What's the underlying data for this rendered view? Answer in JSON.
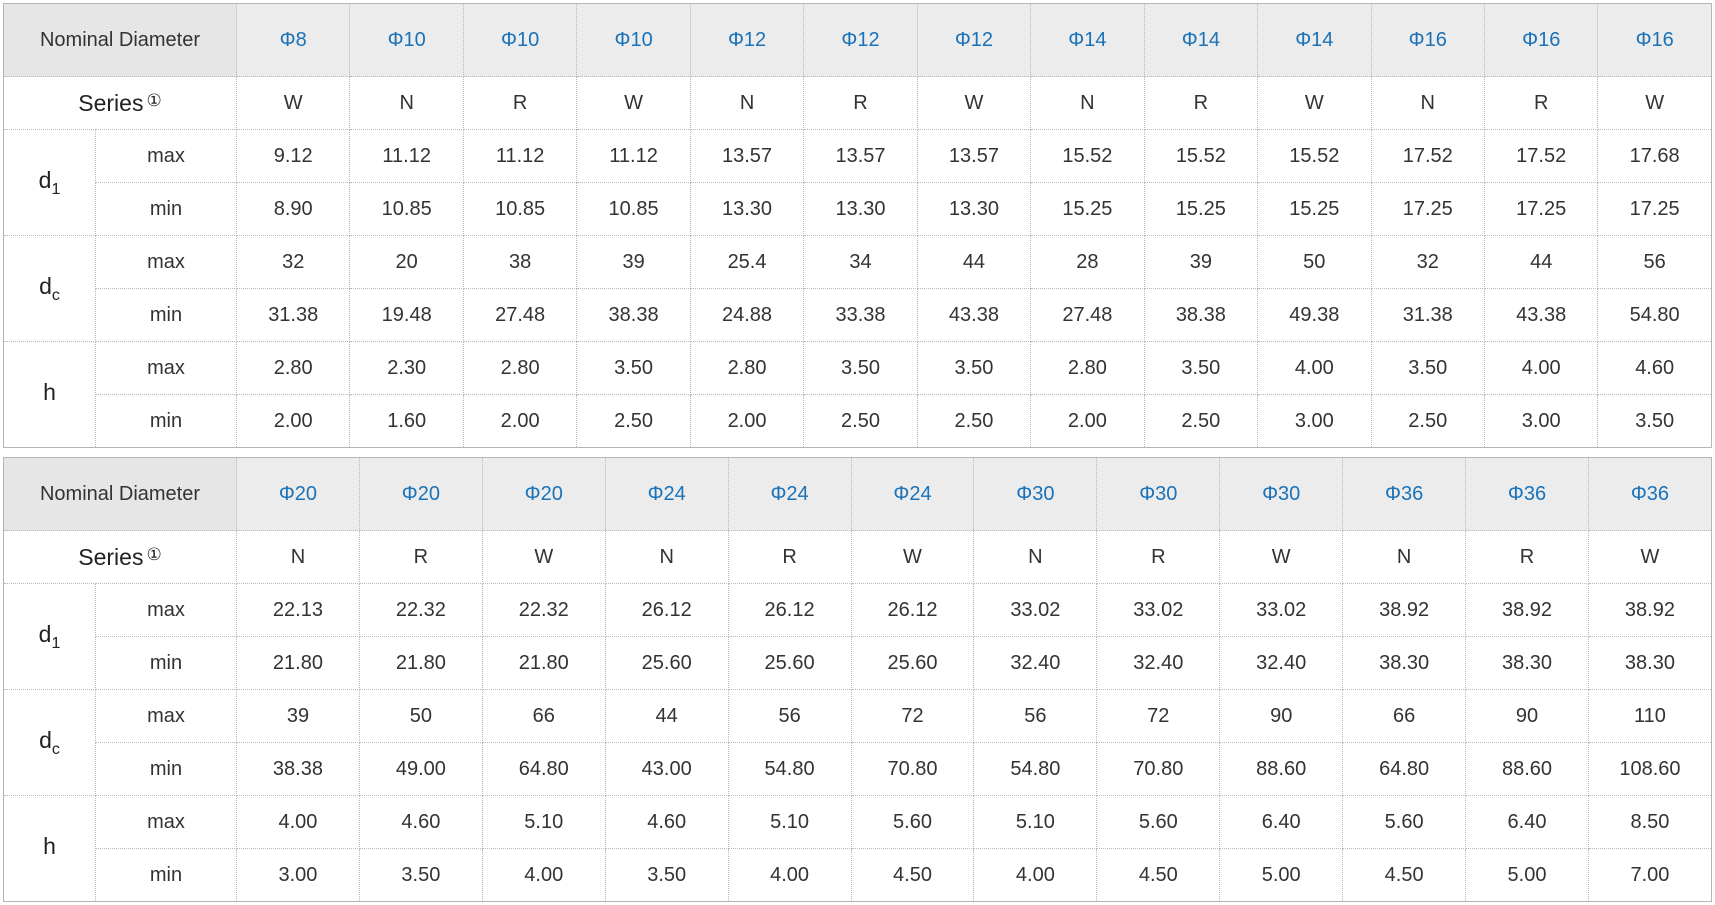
{
  "header_label": "Nominal Diameter",
  "series_label": "Series",
  "series_note": "①",
  "params": [
    {
      "symbol": "d",
      "sub": "1"
    },
    {
      "symbol": "d",
      "sub": "c"
    },
    {
      "symbol": "h",
      "sub": ""
    }
  ],
  "limit_labels": [
    "max",
    "min"
  ],
  "tables": [
    {
      "diameters": [
        "Φ8",
        "Φ10",
        "Φ10",
        "Φ10",
        "Φ12",
        "Φ12",
        "Φ12",
        "Φ14",
        "Φ14",
        "Φ14",
        "Φ16",
        "Φ16",
        "Φ16"
      ],
      "series": [
        "W",
        "N",
        "R",
        "W",
        "N",
        "R",
        "W",
        "N",
        "R",
        "W",
        "N",
        "R",
        "W"
      ],
      "rows": [
        [
          "9.12",
          "11.12",
          "11.12",
          "11.12",
          "13.57",
          "13.57",
          "13.57",
          "15.52",
          "15.52",
          "15.52",
          "17.52",
          "17.52",
          "17.68"
        ],
        [
          "8.90",
          "10.85",
          "10.85",
          "10.85",
          "13.30",
          "13.30",
          "13.30",
          "15.25",
          "15.25",
          "15.25",
          "17.25",
          "17.25",
          "17.25"
        ],
        [
          "32",
          "20",
          "38",
          "39",
          "25.4",
          "34",
          "44",
          "28",
          "39",
          "50",
          "32",
          "44",
          "56"
        ],
        [
          "31.38",
          "19.48",
          "27.48",
          "38.38",
          "24.88",
          "33.38",
          "43.38",
          "27.48",
          "38.38",
          "49.38",
          "31.38",
          "43.38",
          "54.80"
        ],
        [
          "2.80",
          "2.30",
          "2.80",
          "3.50",
          "2.80",
          "3.50",
          "3.50",
          "2.80",
          "3.50",
          "4.00",
          "3.50",
          "4.00",
          "4.60"
        ],
        [
          "2.00",
          "1.60",
          "2.00",
          "2.50",
          "2.00",
          "2.50",
          "2.50",
          "2.00",
          "2.50",
          "3.00",
          "2.50",
          "3.00",
          "3.50"
        ]
      ]
    },
    {
      "diameters": [
        "Φ20",
        "Φ20",
        "Φ20",
        "Φ24",
        "Φ24",
        "Φ24",
        "Φ30",
        "Φ30",
        "Φ30",
        "Φ36",
        "Φ36",
        "Φ36"
      ],
      "series": [
        "N",
        "R",
        "W",
        "N",
        "R",
        "W",
        "N",
        "R",
        "W",
        "N",
        "R",
        "W"
      ],
      "rows": [
        [
          "22.13",
          "22.32",
          "22.32",
          "26.12",
          "26.12",
          "26.12",
          "33.02",
          "33.02",
          "33.02",
          "38.92",
          "38.92",
          "38.92"
        ],
        [
          "21.80",
          "21.80",
          "21.80",
          "25.60",
          "25.60",
          "25.60",
          "32.40",
          "32.40",
          "32.40",
          "38.30",
          "38.30",
          "38.30"
        ],
        [
          "39",
          "50",
          "66",
          "44",
          "56",
          "72",
          "56",
          "72",
          "90",
          "66",
          "90",
          "110"
        ],
        [
          "38.38",
          "49.00",
          "64.80",
          "43.00",
          "54.80",
          "70.80",
          "54.80",
          "70.80",
          "88.60",
          "64.80",
          "88.60",
          "108.60"
        ],
        [
          "4.00",
          "4.60",
          "5.10",
          "4.60",
          "5.10",
          "5.60",
          "5.10",
          "5.60",
          "6.40",
          "5.60",
          "6.40",
          "8.50"
        ],
        [
          "3.00",
          "3.50",
          "4.00",
          "3.50",
          "4.00",
          "4.50",
          "4.00",
          "4.50",
          "5.00",
          "4.50",
          "5.00",
          "7.00"
        ]
      ]
    }
  ]
}
